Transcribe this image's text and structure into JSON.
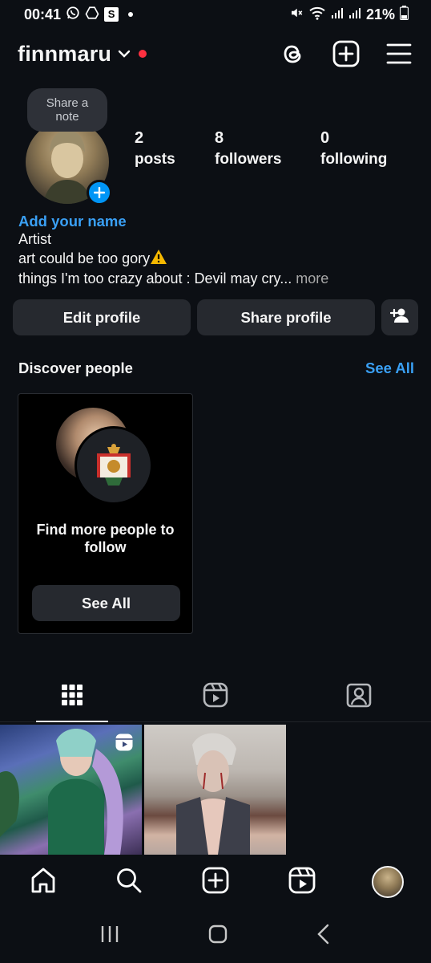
{
  "status_bar": {
    "time": "00:41",
    "left_icons": [
      "whatsapp-icon",
      "drive-icon",
      "s-app-icon",
      "dot"
    ],
    "right_icons": [
      "mute-icon",
      "wifi-icon",
      "signal-icon",
      "signal-icon"
    ],
    "s_app_letter": "S",
    "battery": "21%"
  },
  "header": {
    "username": "finnmaru",
    "actions": [
      "threads-icon",
      "create-icon",
      "menu-icon"
    ]
  },
  "profile": {
    "note_placeholder": "Share a note",
    "stats": [
      {
        "value": "2",
        "label": "posts"
      },
      {
        "value": "8",
        "label": "followers"
      },
      {
        "value": "0",
        "label": "following"
      }
    ],
    "add_name": "Add your name",
    "bio_lines": [
      "Artist",
      "art could be too gory",
      "things I'm too crazy about : Devil may cry"
    ],
    "bio_ellipsis": "...",
    "more": " more"
  },
  "buttons": {
    "edit": "Edit profile",
    "share": "Share profile"
  },
  "discover": {
    "title": "Discover people",
    "see_all": "See All",
    "card_text": "Find more people to follow",
    "card_button": "See All"
  },
  "tabs": [
    "grid-icon",
    "reels-icon",
    "tagged-icon"
  ],
  "bottom_nav": [
    "home-icon",
    "search-icon",
    "create-icon",
    "reels-icon",
    "profile-avatar"
  ],
  "colors": {
    "background": "#0c0f14",
    "accent_blue": "#0095f6",
    "link_blue": "#3aa0f5",
    "button_bg": "#26292f",
    "red_dot": "#ff3040"
  }
}
